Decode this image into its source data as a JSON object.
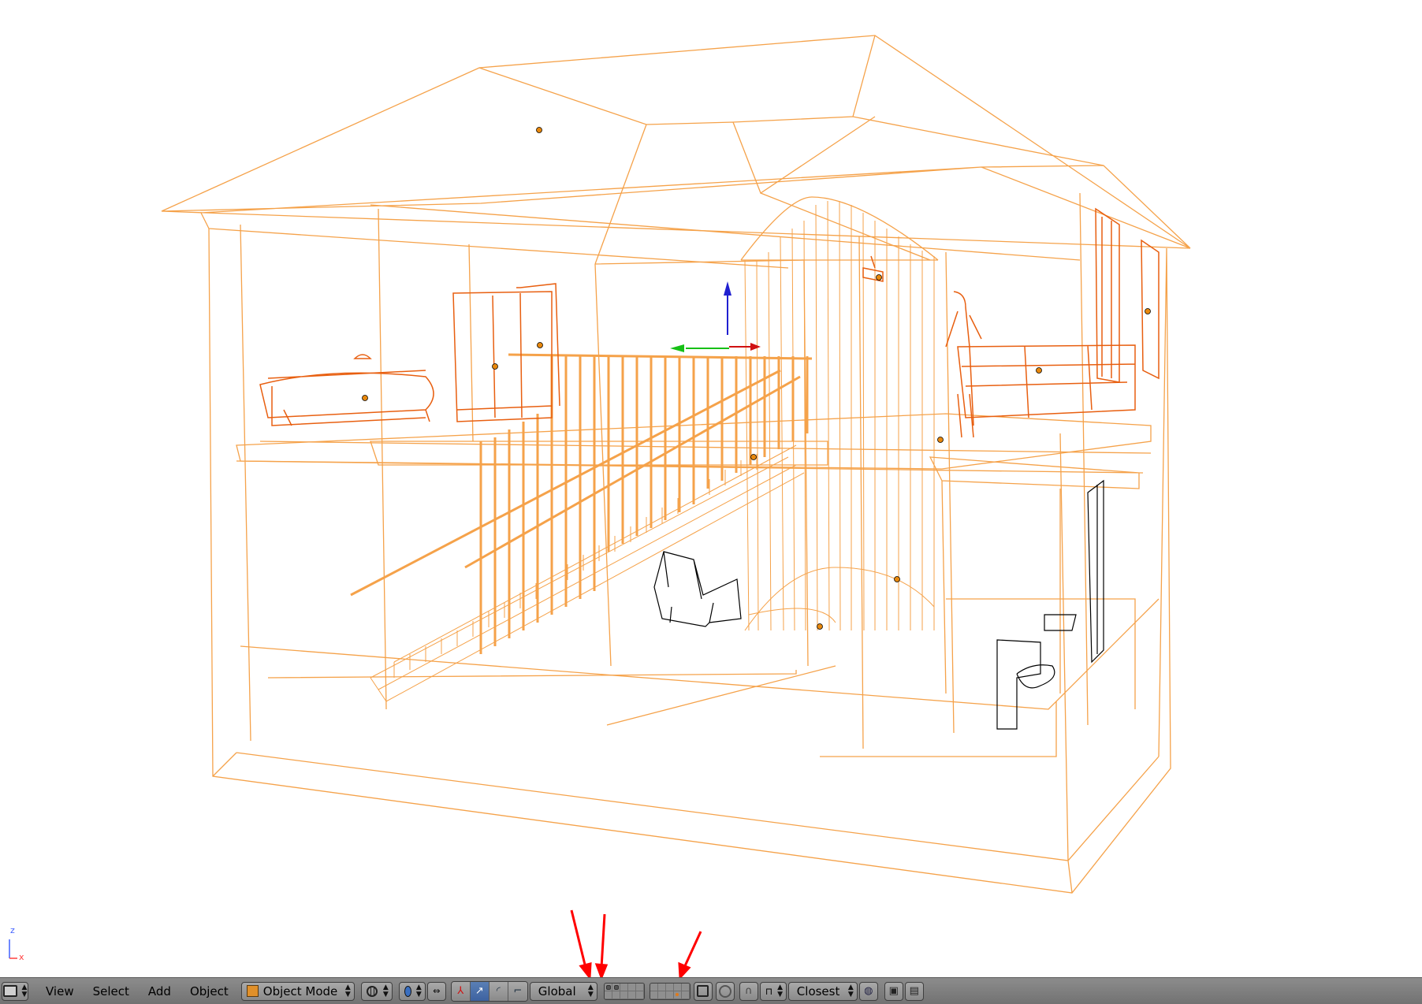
{
  "viewport": {
    "axis_labels": {
      "z": "z",
      "x": "x"
    },
    "colors": {
      "background": "#ffffff",
      "selected_wire": "#f5a24a",
      "active_wire": "#e85f10",
      "unselected_wire": "#000000",
      "annotation_arrow": "#ff0000"
    }
  },
  "header": {
    "editor_type_icon": "3d-view-icon",
    "menus": [
      "View",
      "Select",
      "Add",
      "Object"
    ],
    "mode": {
      "label": "Object Mode",
      "icon": "object-cube-icon"
    },
    "viewport_shading_icon": "wireframe-sphere-icon",
    "pivot_icon": "pivot-point-icon",
    "transform_orientation": "Global",
    "layer_grid": {
      "rows": 2,
      "cols": 10,
      "active_dots": [
        0,
        1
      ],
      "object_dot_layer": 19
    },
    "snap_element": "Closest",
    "colors": {
      "header_bg": "#7f7f7f",
      "active_button": "#4a6fab"
    }
  }
}
